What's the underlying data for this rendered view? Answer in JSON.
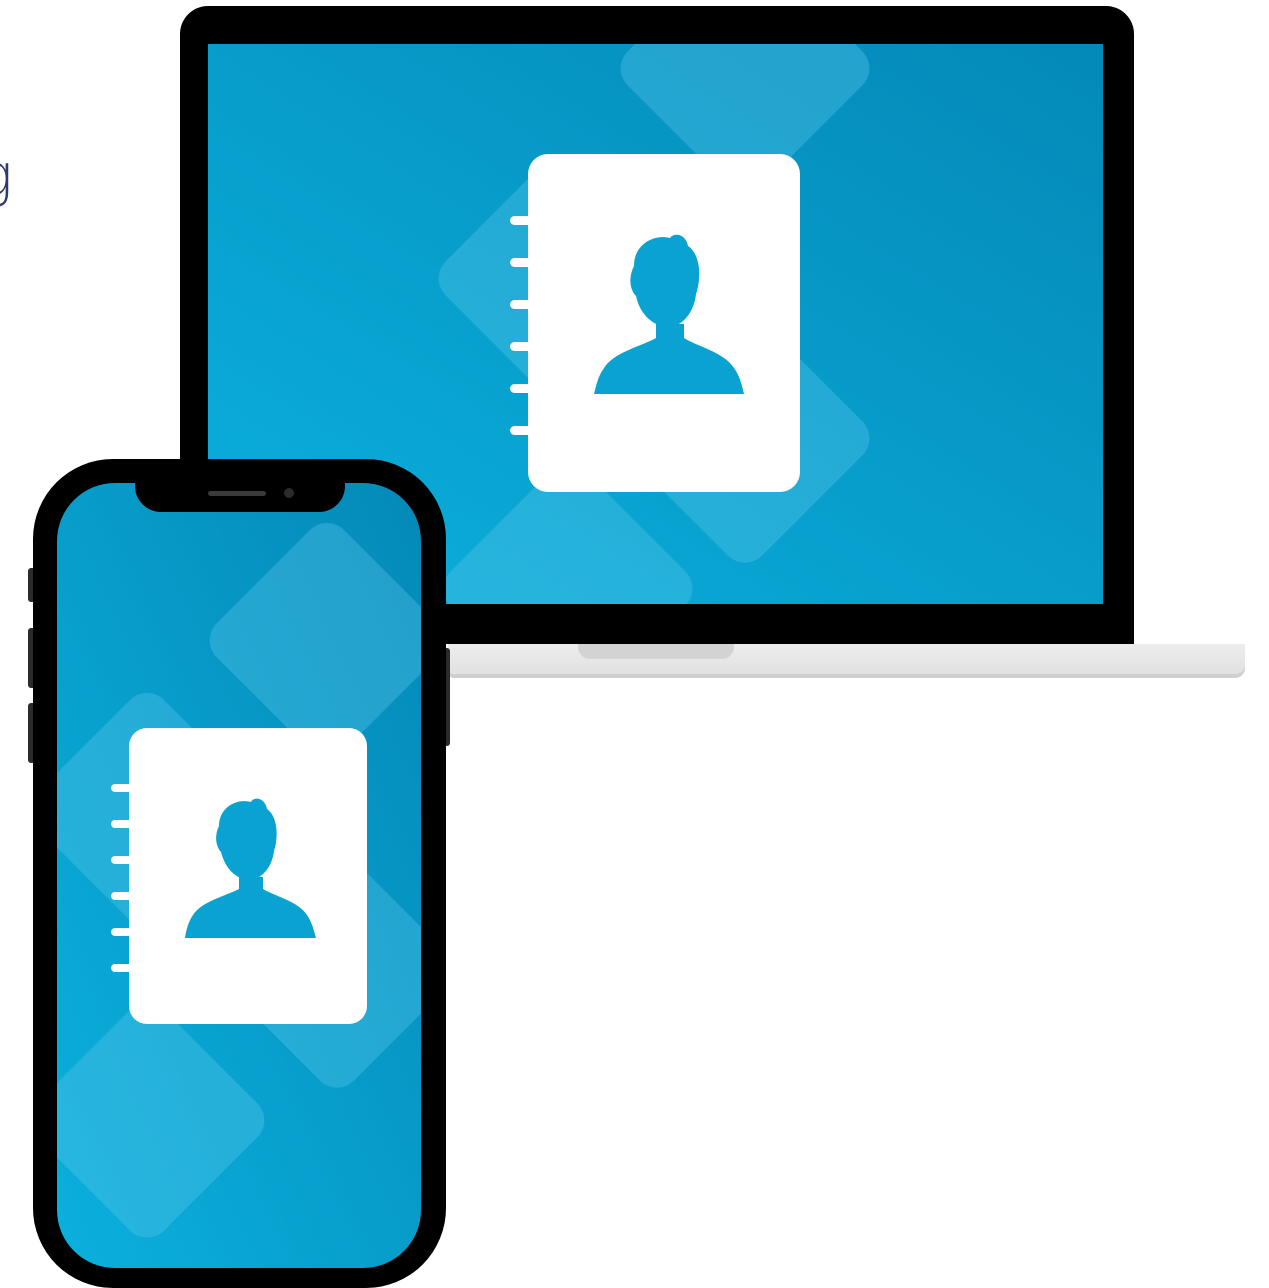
{
  "stray_text": {
    "value": "g",
    "color": "#2d3a6b"
  },
  "screens": {
    "gradient_light": "#0bb0dd",
    "gradient_dark": "#0489b8",
    "tile_color": "#5cc8ea",
    "book_color": "#ffffff",
    "person_color": "#0aa2d1"
  },
  "laptop": {
    "bezel_color": "#000000",
    "base_color": "#e6e6e6",
    "screen_icon": "contact-book-icon"
  },
  "phone": {
    "body_color": "#000000",
    "screen_icon": "contact-book-icon"
  }
}
